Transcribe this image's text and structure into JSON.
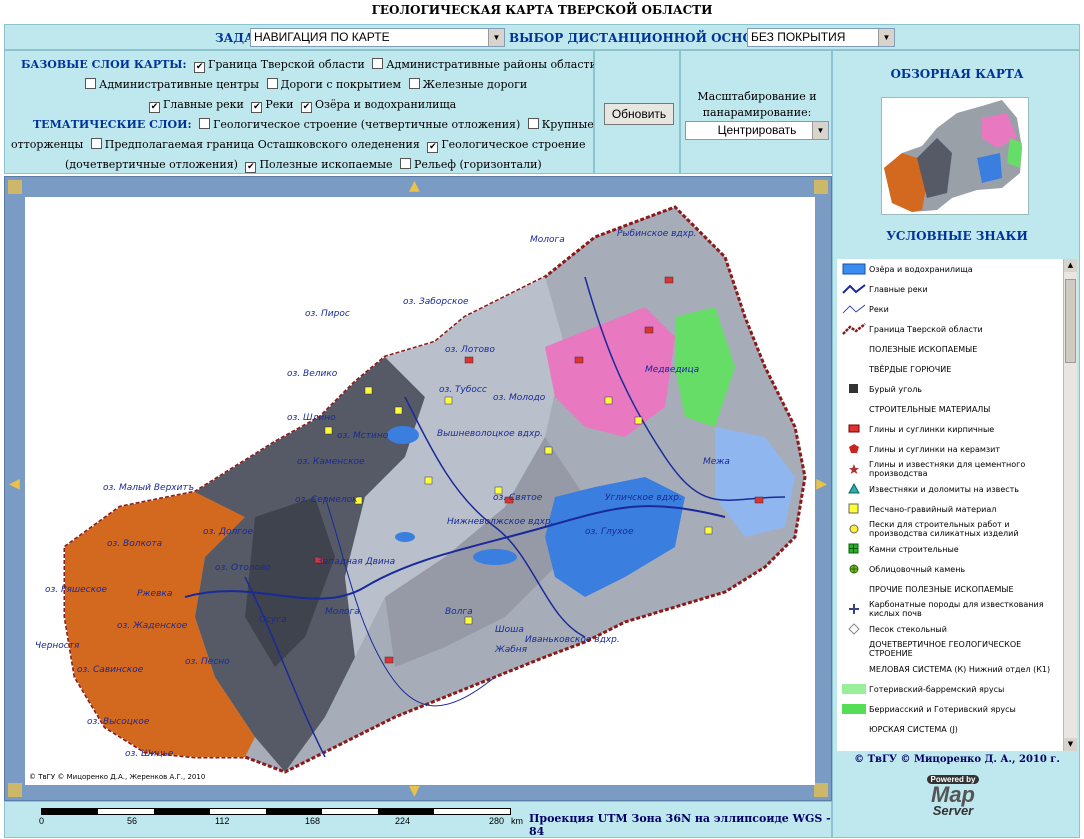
{
  "page_title": "ГЕОЛОГИЧЕСКАЯ КАРТА ТВЕРСКОЙ ОБЛАСТИ",
  "top_bar": {
    "tasks_label": "ЗАДАЧИ:",
    "tasks_value": "НАВИГАЦИЯ ПО КАРТЕ",
    "basemap_label": "ВЫБОР ДИСТАНЦИОННОЙ ОСНОВЫ:",
    "basemap_value": "БЕЗ ПОКРЫТИЯ"
  },
  "layers": {
    "base_header": "БАЗОВЫЕ СЛОИ КАРТЫ:",
    "thematic_header": "ТЕМАТИЧЕСКИЕ СЛОИ:",
    "base": [
      {
        "label": "Граница Тверской области",
        "checked": true
      },
      {
        "label": "Административные районы области",
        "checked": false
      },
      {
        "label": "Административные центры",
        "checked": false
      },
      {
        "label": "Дороги с покрытием",
        "checked": false
      },
      {
        "label": "Железные дороги",
        "checked": false
      },
      {
        "label": "Главные реки",
        "checked": true
      },
      {
        "label": "Реки",
        "checked": true
      },
      {
        "label": "Озёра и водохранилища",
        "checked": true
      }
    ],
    "thematic": [
      {
        "label": "Геологическое строение (четвертичные отложения)",
        "checked": false
      },
      {
        "label": "Крупные",
        "checked": false
      },
      {
        "label": "отторженцы",
        "checked": false
      },
      {
        "label": "Предполагаемая граница Осташковского оледенения",
        "checked": false
      },
      {
        "label": "Геологическое строение",
        "checked": true
      },
      {
        "label": "(дочетвертичные отложения)",
        "checked": false
      },
      {
        "label": "Полезные ископаемые",
        "checked": true
      },
      {
        "label": "Рельеф (горизонтали)",
        "checked": false
      }
    ]
  },
  "update_button": "Обновить",
  "scale_control": {
    "label": "Масштабирование и панарамирование:",
    "value": "Центрировать"
  },
  "right": {
    "overview_title": "ОБЗОРНАЯ КАРТА",
    "legend_title": "УСЛОВНЫЕ ЗНАКИ",
    "legend": [
      {
        "symbol": "lake",
        "text": "Озёра и водохранилища"
      },
      {
        "symbol": "main-river",
        "text": "Главные реки"
      },
      {
        "symbol": "river",
        "text": "Реки"
      },
      {
        "symbol": "border",
        "text": "Граница Тверской области"
      },
      {
        "symbol": "",
        "text": "ПОЛЕЗНЫЕ ИСКОПАЕМЫЕ"
      },
      {
        "symbol": "",
        "text": "ТВЁРДЫЕ ГОРЮЧИЕ"
      },
      {
        "symbol": "coal",
        "text": "Бурый уголь"
      },
      {
        "symbol": "",
        "text": "СТРОИТЕЛЬНЫЕ МАТЕРИАЛЫ"
      },
      {
        "symbol": "brick-clay",
        "text": "Глины и суглинки кирпичные"
      },
      {
        "symbol": "keramzit",
        "text": "Глины и суглинки на керамзит"
      },
      {
        "symbol": "cement",
        "text": "Глины и известняки для цементного производства"
      },
      {
        "symbol": "limestone",
        "text": "Известняки и доломиты на известь"
      },
      {
        "symbol": "sand-gravel",
        "text": "Песчано-гравийный материал"
      },
      {
        "symbol": "sand",
        "text": "Пески для строительных работ и производства силикатных изделий"
      },
      {
        "symbol": "stone",
        "text": "Камни строительные"
      },
      {
        "symbol": "facing",
        "text": "Облицовочный камень"
      },
      {
        "symbol": "",
        "text": "ПРОЧИЕ ПОЛЕЗНЫЕ ИСКОПАЕМЫЕ"
      },
      {
        "symbol": "carbonate",
        "text": "Карбонатные породы для известкования кислых почв"
      },
      {
        "symbol": "glass-sand",
        "text": "Песок стекольный"
      },
      {
        "symbol": "",
        "text": "ДОЧЕТВЕРТИЧНОЕ ГЕОЛОГИЧЕСКОЕ СТРОЕНИЕ"
      },
      {
        "symbol": "",
        "text": "МЕЛОВАЯ СИСТЕМА (К) Нижний отдел (К1)"
      },
      {
        "symbol": "hauterivian",
        "text": "Готеривский-барремский ярусы"
      },
      {
        "symbol": "berriasian",
        "text": "Берриасский и Готеривский ярусы"
      },
      {
        "symbol": "",
        "text": "ЮРСКАЯ СИСТЕМА (J)"
      }
    ],
    "copyright": "© ТвГУ © Мицоренко Д. А., 2010 г.",
    "logo": {
      "powered": "Powered by",
      "map": "Map",
      "server": "Server"
    }
  },
  "map": {
    "copyright": "© ТвГУ © Мицоренко Д.А., Жеренков А.Г., 2010",
    "labels": [
      "оз. Пирос",
      "оз. Заборское",
      "оз. Велико",
      "оз. Шлино",
      "оз. Мстино",
      "оз. Каменское",
      "оз. Малый Верхитъ",
      "оз. Сермелок",
      "оз. Долгое",
      "оз. Отолово",
      "оз. Волкота",
      "оз. Ряшеское",
      "оз. Жаденское",
      "оз. Песно",
      "оз. Савинское",
      "оз. Высоцкое",
      "оз. Шицье",
      "Вышневолоцкое вдхр.",
      "Нижневолжское вдхр.",
      "Иваньковское вдхр.",
      "Угличское вдхр.",
      "Рыбинское вдхр.",
      "оз. Тубосс",
      "оз. Лотово",
      "оз. Молодо",
      "оз. Святое",
      "оз. Глухое",
      "Молога",
      "Медведица",
      "Волга",
      "Шоша",
      "Межа",
      "Западная Двина",
      "Осуга",
      "Черностя",
      "Ржевка",
      "Мологa",
      "Жабня"
    ]
  },
  "bottom": {
    "scale_labels": [
      "0",
      "56",
      "112",
      "168",
      "224",
      "280"
    ],
    "scale_unit": "km",
    "projection": "Проекция UTM Зона 36N на эллипсоиде WGS - 84"
  },
  "colors": {
    "panel": "#bfe7ee",
    "accent": "#003399",
    "map_frame": "#7a9bc4",
    "lake": "#3a7fe0",
    "orange": "#d2691e",
    "dark_gray": "#555a66"
  }
}
